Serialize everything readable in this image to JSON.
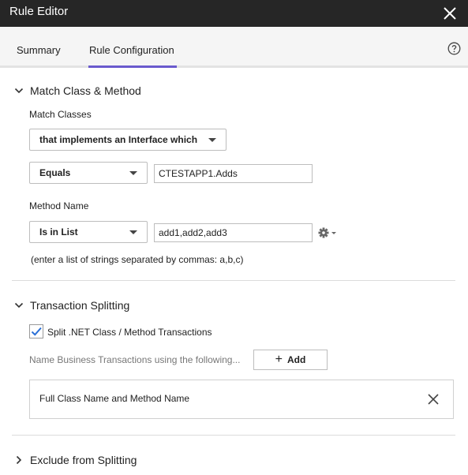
{
  "window": {
    "title": "Rule Editor",
    "close_icon": "close-icon"
  },
  "tabs": [
    {
      "label": "Summary",
      "active": false
    },
    {
      "label": "Rule Configuration",
      "active": true
    }
  ],
  "accent_color": "#6a5acd",
  "match_section": {
    "title": "Match Class & Method",
    "expanded": true,
    "match_classes_label": "Match Classes",
    "class_type_select": "that implements an Interface which",
    "class_operator_select": "Equals",
    "class_value": "CTESTAPP1.Adds",
    "method_name_label": "Method Name",
    "method_operator_select": "Is in List",
    "method_value": "add1,add2,add3",
    "method_hint": "(enter a list of strings separated by commas: a,b,c)"
  },
  "splitting_section": {
    "title": "Transaction Splitting",
    "expanded": true,
    "checkbox_label": "Split .NET Class / Method Transactions",
    "checkbox_checked": true,
    "naming_label": "Name Business Transactions using the following...",
    "add_button": "Add",
    "naming_item": "Full Class Name and Method Name"
  },
  "exclude_section": {
    "title": "Exclude from Splitting",
    "expanded": false
  }
}
